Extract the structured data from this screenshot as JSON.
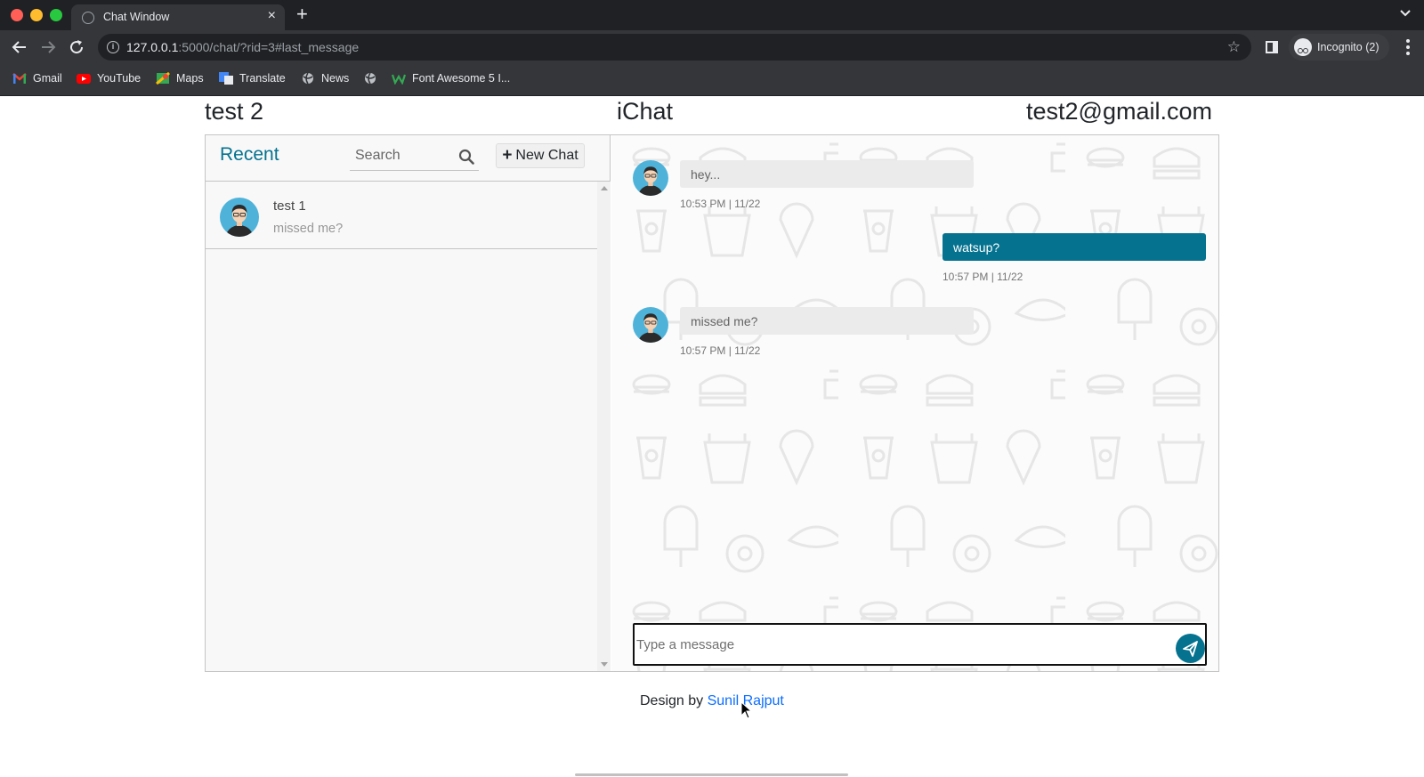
{
  "browser": {
    "tab_title": "Chat Window",
    "tab_close": "×",
    "new_tab": "+",
    "url_host": "127.0.0.1",
    "url_rest": ":5000/chat/?rid=3#last_message",
    "incognito_label": "Incognito (2)",
    "bookmarks": [
      {
        "label": "Gmail",
        "icon": "gmail-icon"
      },
      {
        "label": "YouTube",
        "icon": "youtube-icon"
      },
      {
        "label": "Maps",
        "icon": "maps-icon"
      },
      {
        "label": "Translate",
        "icon": "translate-icon"
      },
      {
        "label": "News",
        "icon": "globe-icon"
      },
      {
        "label": "",
        "icon": "globe-icon"
      },
      {
        "label": "Font Awesome 5 I...",
        "icon": "fontawesome-icon"
      }
    ]
  },
  "header": {
    "username": "test 2",
    "brand": "iChat",
    "email": "test2@gmail.com"
  },
  "sidebar": {
    "title": "Recent",
    "search_placeholder": "Search",
    "new_chat_label": "New Chat",
    "chats": [
      {
        "name": "test 1",
        "preview": "missed me?"
      }
    ]
  },
  "messages": [
    {
      "direction": "incoming",
      "text": "hey...",
      "time": "10:53 PM | 11/22"
    },
    {
      "direction": "outgoing",
      "text": "watsup?",
      "time": "10:57 PM | 11/22"
    },
    {
      "direction": "incoming",
      "text": "missed me?",
      "time": "10:57 PM | 11/22"
    }
  ],
  "composer": {
    "placeholder": "Type a message"
  },
  "footer": {
    "prefix": "Design by ",
    "author": "Sunil Rajput"
  },
  "colors": {
    "accent": "#05728f",
    "link": "#0d6efd",
    "incoming_bubble": "#ebebeb"
  }
}
